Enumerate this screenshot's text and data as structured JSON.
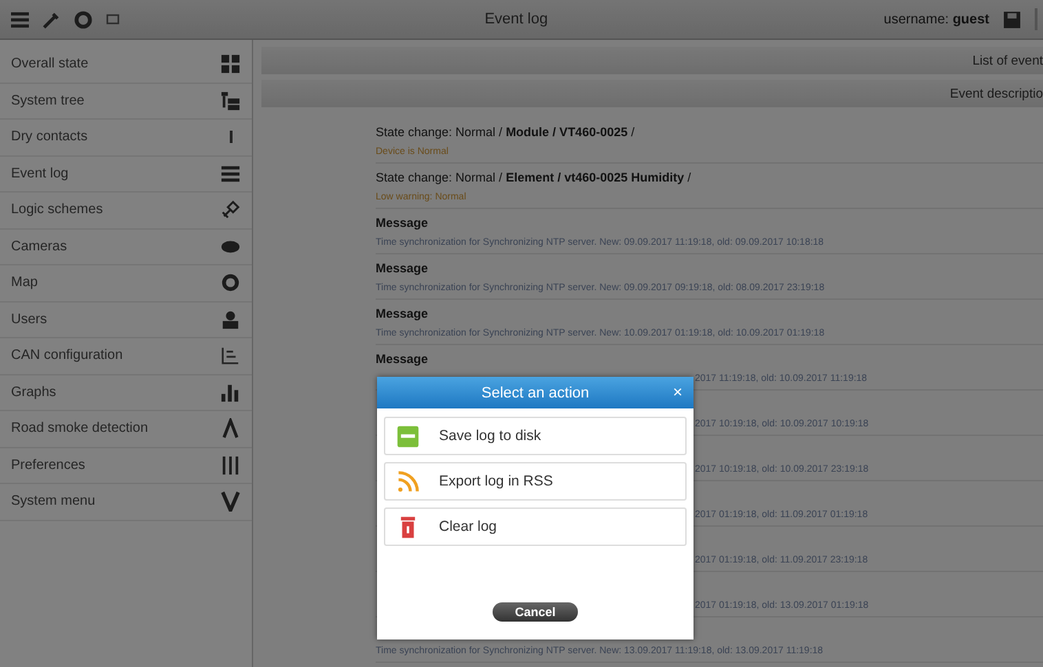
{
  "toolbar": {
    "title": "Event log",
    "user_label": "username:",
    "user_name": "guest"
  },
  "sidebar": {
    "items": [
      {
        "label": "Overall state"
      },
      {
        "label": "System tree"
      },
      {
        "label": "Dry contacts"
      },
      {
        "label": "Event log"
      },
      {
        "label": "Logic schemes"
      },
      {
        "label": "Cameras"
      },
      {
        "label": "Map"
      },
      {
        "label": "Users"
      },
      {
        "label": "CAN configuration"
      },
      {
        "label": "Graphs"
      },
      {
        "label": "Road smoke detection"
      },
      {
        "label": "Preferences"
      },
      {
        "label": "System menu"
      }
    ]
  },
  "table": {
    "header_rows": [
      "List of event",
      "Event descriptio"
    ],
    "entries": [
      {
        "kind": "state",
        "title": "State change: Normal / **Module / VT460-0025** /",
        "detail": "Device is Normal"
      },
      {
        "kind": "state",
        "title": "State change: Normal / **Element / vt460-0025 Humidity** /",
        "detail": "Low warning: Normal"
      },
      {
        "kind": "message",
        "title": "Message",
        "detail": "Time synchronization for Synchronizing NTP server. New: 09.09.2017 11:19:18, old: 09.09.2017 10:18:18"
      },
      {
        "kind": "message",
        "title": "Message",
        "detail": "Time synchronization for Synchronizing NTP server. New: 09.09.2017 09:19:18, old: 08.09.2017 23:19:18"
      },
      {
        "kind": "message",
        "title": "Message",
        "detail": "Time synchronization for Synchronizing NTP server. New: 10.09.2017 01:19:18, old: 10.09.2017 01:19:18"
      },
      {
        "kind": "message",
        "title": "Message",
        "tail": "2017 11:19:18, old: 10.09.2017 11:19:18"
      },
      {
        "kind": "message",
        "tail": "2017 10:19:18, old: 10.09.2017 10:19:18"
      },
      {
        "kind": "message",
        "tail": "2017 10:19:18, old: 10.09.2017 23:19:18"
      },
      {
        "kind": "message",
        "tail": "2017 01:19:18, old: 11.09.2017 01:19:18"
      },
      {
        "kind": "message",
        "tail": "2017 01:19:18, old: 11.09.2017 23:19:18"
      },
      {
        "kind": "message",
        "tail": "2017 01:19:18, old: 13.09.2017 01:19:18"
      },
      {
        "kind": "message",
        "detail": "Time synchronization for Synchronizing NTP server. New: 13.09.2017 11:19:18, old: 13.09.2017 11:19:18"
      }
    ]
  },
  "dialog": {
    "title": "Select an action",
    "close": "×",
    "actions": [
      {
        "kind": "save",
        "label": "Save log to disk"
      },
      {
        "kind": "rss",
        "label": "Export log in RSS"
      },
      {
        "kind": "trash",
        "label": "Clear log"
      }
    ],
    "cancel": "Cancel"
  }
}
